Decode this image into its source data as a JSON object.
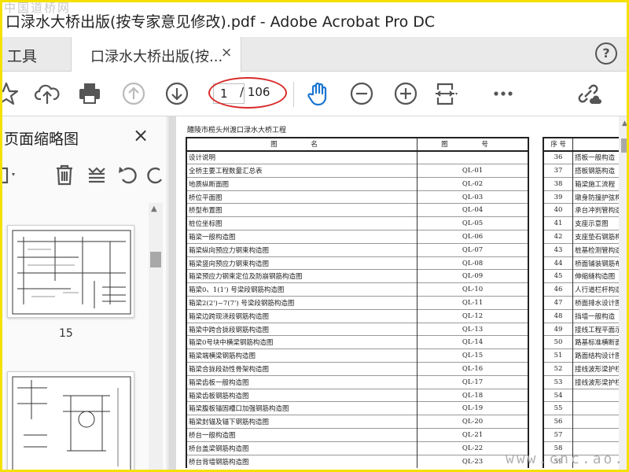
{
  "window": {
    "title": "口渌水大桥出版(按专家意见修改).pdf - Adobe Acrobat Pro DC",
    "watermark_top": "中国道桥网"
  },
  "tabs": {
    "tools_label": "工具",
    "doc_label": "口渌水大桥出版(按...",
    "close_glyph": "×",
    "help_glyph": "?"
  },
  "toolbar": {
    "current_page": "1",
    "total_pages": "/ 106",
    "icons": [
      "star-icon",
      "cloud-upload-icon",
      "print-icon",
      "page-up-icon",
      "page-down-icon",
      "hand-tool-icon",
      "zoom-out-icon",
      "zoom-in-icon",
      "fit-page-icon",
      "more-icon",
      "share-link-icon"
    ]
  },
  "sidepanel": {
    "title": "页面缩略图",
    "close_glyph": "×",
    "thumbnail_page_number": "15"
  },
  "document": {
    "heading": "醴陵市榄头州渡口渌水大桥工程",
    "left_table": {
      "headers": [
        "图 名",
        "图 号"
      ],
      "rows": [
        [
          "设计说明",
          ""
        ],
        [
          "全桥主要工程数量汇总表",
          "QL-01"
        ],
        [
          "地质纵断面图",
          "QL-02"
        ],
        [
          "桥位平面图",
          "QL-03"
        ],
        [
          "桥型布置图",
          "QL-04"
        ],
        [
          "桩位坐标图",
          "QL-05"
        ],
        [
          "箱梁一般构造图",
          "QL-06"
        ],
        [
          "箱梁纵向预应力钢束构造图",
          "QL-07"
        ],
        [
          "箱梁竖向预应力钢束构造图",
          "QL-08"
        ],
        [
          "箱梁预应力钢束定位及防崩钢筋构造图",
          "QL-09"
        ],
        [
          "箱梁0、1(1') 号梁段钢筋构造图",
          "QL-10"
        ],
        [
          "箱梁2(2')~7(7') 号梁段钢筋构造图",
          "QL-11"
        ],
        [
          "箱梁边跨现浇段钢筋构造图",
          "QL-12"
        ],
        [
          "箱梁中跨合拢段钢筋构造图",
          "QL-13"
        ],
        [
          "箱梁0号块中横梁钢筋构造图",
          "QL-14"
        ],
        [
          "箱梁端横梁钢筋构造图",
          "QL-15"
        ],
        [
          "箱梁合拢段劲性骨架构造图",
          "QL-16"
        ],
        [
          "箱梁齿板一般构造图",
          "QL-17"
        ],
        [
          "箱梁齿板钢筋构造图",
          "QL-18"
        ],
        [
          "箱梁腹板锚固槽口加强钢筋构造图",
          "QL-19"
        ],
        [
          "箱梁封锚及锚下钢筋构造图",
          "QL-20"
        ],
        [
          "桥台一般构造图",
          "QL-21"
        ],
        [
          "桥台盖梁钢筋构造图",
          "QL-22"
        ],
        [
          "桥台背墙钢筋构造图",
          "QL-23"
        ]
      ]
    },
    "right_table": {
      "headers": [
        "序 号",
        ""
      ],
      "rows": [
        [
          "36",
          "搭板一般构造"
        ],
        [
          "37",
          "搭板钢筋构造"
        ],
        [
          "38",
          "箱梁施工流程"
        ],
        [
          "39",
          "墩身防撞护弦构"
        ],
        [
          "40",
          "承台冲刿管构造"
        ],
        [
          "41",
          "支座示意图"
        ],
        [
          "42",
          "支座垫石钢筋构"
        ],
        [
          "43",
          "桩基检测管构造"
        ],
        [
          "44",
          "桥面铺装钢筋布"
        ],
        [
          "45",
          "伸缩缝构造图"
        ],
        [
          "46",
          "人行道栏杆构造"
        ],
        [
          "47",
          "桥面排水设计图"
        ],
        [
          "48",
          "挡墙一般构造"
        ],
        [
          "49",
          "接线工程平面示"
        ],
        [
          "50",
          "路基标准横断面"
        ],
        [
          "51",
          "路面结构设计图"
        ],
        [
          "52",
          "接线波形梁护栏"
        ],
        [
          "53",
          "接线波形梁护栏"
        ],
        [
          "54",
          ""
        ],
        [
          "55",
          ""
        ],
        [
          "56",
          ""
        ],
        [
          "57",
          ""
        ],
        [
          "58",
          ""
        ],
        [
          "59",
          ""
        ]
      ]
    }
  },
  "watermark_bottom": "www.cnc.ao.com"
}
